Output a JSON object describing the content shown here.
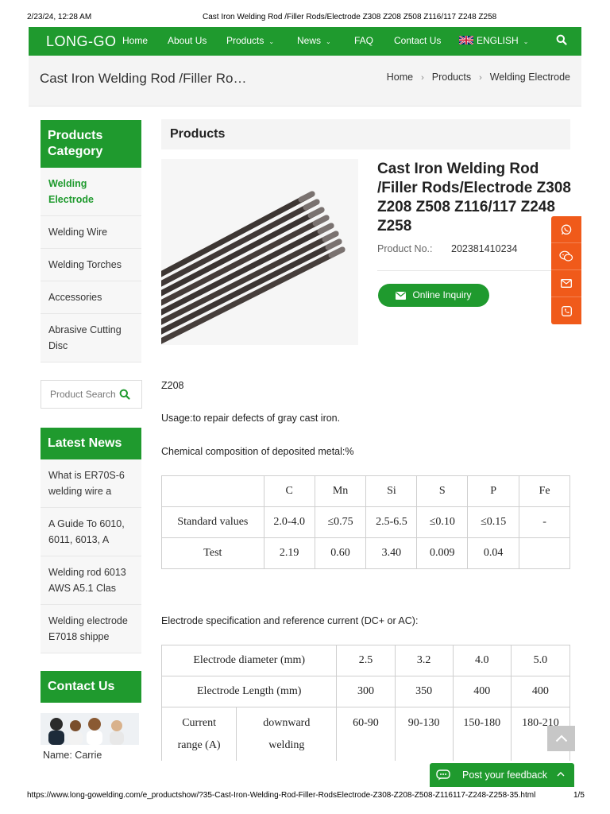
{
  "print_header": {
    "date": "2/23/24, 12:28 AM",
    "title": "Cast Iron Welding Rod /Filler Rods/Electrode Z308 Z208 Z508 Z116/117 Z248 Z258"
  },
  "navbar": {
    "logo": "LONG-GO",
    "items": [
      {
        "label": "Home",
        "has_dropdown": false
      },
      {
        "label": "About Us",
        "has_dropdown": false
      },
      {
        "label": "Products",
        "has_dropdown": true
      },
      {
        "label": "News",
        "has_dropdown": true
      },
      {
        "label": "FAQ",
        "has_dropdown": false
      },
      {
        "label": "Contact Us",
        "has_dropdown": false
      }
    ],
    "language": "ENGLISH",
    "search_icon": "search-icon",
    "color": "#1f9a2e"
  },
  "title_bar": {
    "page_title": "Cast Iron Welding Rod /Filler Ro…",
    "breadcrumb": [
      "Home",
      "Products",
      "Welding Electrode"
    ]
  },
  "sidebar": {
    "category_title": "Products Category",
    "categories": [
      {
        "label": "Welding Electrode",
        "active": true
      },
      {
        "label": "Welding Wire",
        "active": false
      },
      {
        "label": "Welding Torches",
        "active": false
      },
      {
        "label": "Accessories",
        "active": false
      },
      {
        "label": "Abrasive Cutting Disc",
        "active": false
      }
    ],
    "search_placeholder": "Product Search",
    "news_title": "Latest News",
    "news": [
      " What is ER70S-6 welding wire a",
      " A Guide To 6010, 6011, 6013, A",
      " Welding rod 6013 AWS A5.1 Clas",
      " Welding electrode E7018 shippe"
    ],
    "contact_title": "Contact Us",
    "contact_name": "Name: Carrie"
  },
  "main": {
    "section_title": "Products",
    "product_title": "Cast Iron Welding Rod /Filler Rods/Electrode Z308 Z208 Z508 Z116/117 Z248 Z258",
    "product_no_label": "Product No.:",
    "product_no": "202381410234",
    "inquiry_button": "Online Inquiry",
    "model": "Z208",
    "usage": "Usage:to repair defects of gray cast iron.",
    "chem_heading": "Chemical composition of deposited metal:%",
    "chem_table": {
      "headers": [
        "",
        "C",
        "Mn",
        "Si",
        "S",
        "P",
        "Fe"
      ],
      "rows": [
        [
          "Standard values",
          "2.0-4.0",
          "≤0.75",
          "2.5-6.5",
          "≤0.10",
          "≤0.15",
          "-"
        ],
        [
          "Test",
          "2.19",
          "0.60",
          "3.40",
          "0.009",
          "0.04",
          ""
        ]
      ]
    },
    "spec_heading": "Electrode specification and reference current (DC+ or AC):",
    "spec_table": {
      "diameter_label": "Electrode diameter (mm)",
      "diameters": [
        "2.5",
        "3.2",
        "4.0",
        "5.0"
      ],
      "length_label": "Electrode Length (mm)",
      "lengths": [
        "300",
        "350",
        "400",
        "400"
      ],
      "current_label": "Current range (A)",
      "position_label": "downward welding",
      "currents": [
        "60-90",
        "90-130",
        "150-180",
        "180-210"
      ]
    }
  },
  "floating": {
    "icons": [
      "whatsapp-icon",
      "wechat-icon",
      "email-icon",
      "phone-icon"
    ],
    "color": "#f05a1a"
  },
  "feedback": {
    "label": "Post your feedback"
  },
  "print_footer": {
    "url": "https://www.long-gowelding.com/e_productshow/?35-Cast-Iron-Welding-Rod-Filler-RodsElectrode-Z308-Z208-Z508-Z116117-Z248-Z258-35.html",
    "page": "1/5"
  }
}
